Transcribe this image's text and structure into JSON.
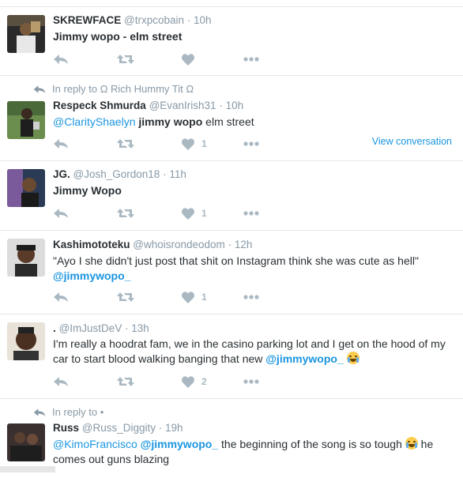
{
  "tweets": [
    {
      "name": "SKREWFACE",
      "handle": "@trxpcobain",
      "time": "10h",
      "text": "Jimmy wopo - elm street",
      "reply_context": "",
      "likes": "",
      "view_conversation": ""
    },
    {
      "name": "Respeck Shmurda",
      "handle": "@EvanIrish31",
      "time": "10h",
      "reply_context": "In reply to Ω Rich Hummy Tit Ω",
      "mention": "@ClarityShaеlyn",
      "text_bold": "jimmy wopo",
      "text_rest": "elm street",
      "likes": "1",
      "view_conversation": "View conversation"
    },
    {
      "name": "JG.",
      "handle": "@Josh_Gordon18",
      "time": "11h",
      "text": "Jimmy Wopo",
      "likes": "1"
    },
    {
      "name": "Kashimototeku",
      "handle": "@whoisrondeodom",
      "time": "12h",
      "text": "\"Ayo I she didn't just post that shit on Instagram think she was cute as hell\"",
      "mention": "@jimmywopo_",
      "likes": "1"
    },
    {
      "name": ".",
      "handle": "@ImJustDeV",
      "time": "13h",
      "text": "I'm really a hoodrat fam, we in the casino parking lot and I get on the hood of my car to start blood walking banging that new",
      "mention": "@jimmywopo_",
      "emoji": "loudly-crying-face",
      "likes": "2"
    },
    {
      "name": "Russ",
      "handle": "@Russ_Diggity",
      "time": "19h",
      "reply_context": "In reply to •",
      "mention1": "@KimoFrancisco",
      "mention2": "@jimmywopo_",
      "text": "the beginning of the song is so tough",
      "emoji": "face-with-tears-of-joy",
      "text2": "he comes out guns blazing"
    }
  ],
  "sep": " · ",
  "colors": {
    "link": "#1b95e0",
    "muted": "#8899a6",
    "icon": "#aab8c2",
    "divider": "#e1e8ed"
  }
}
